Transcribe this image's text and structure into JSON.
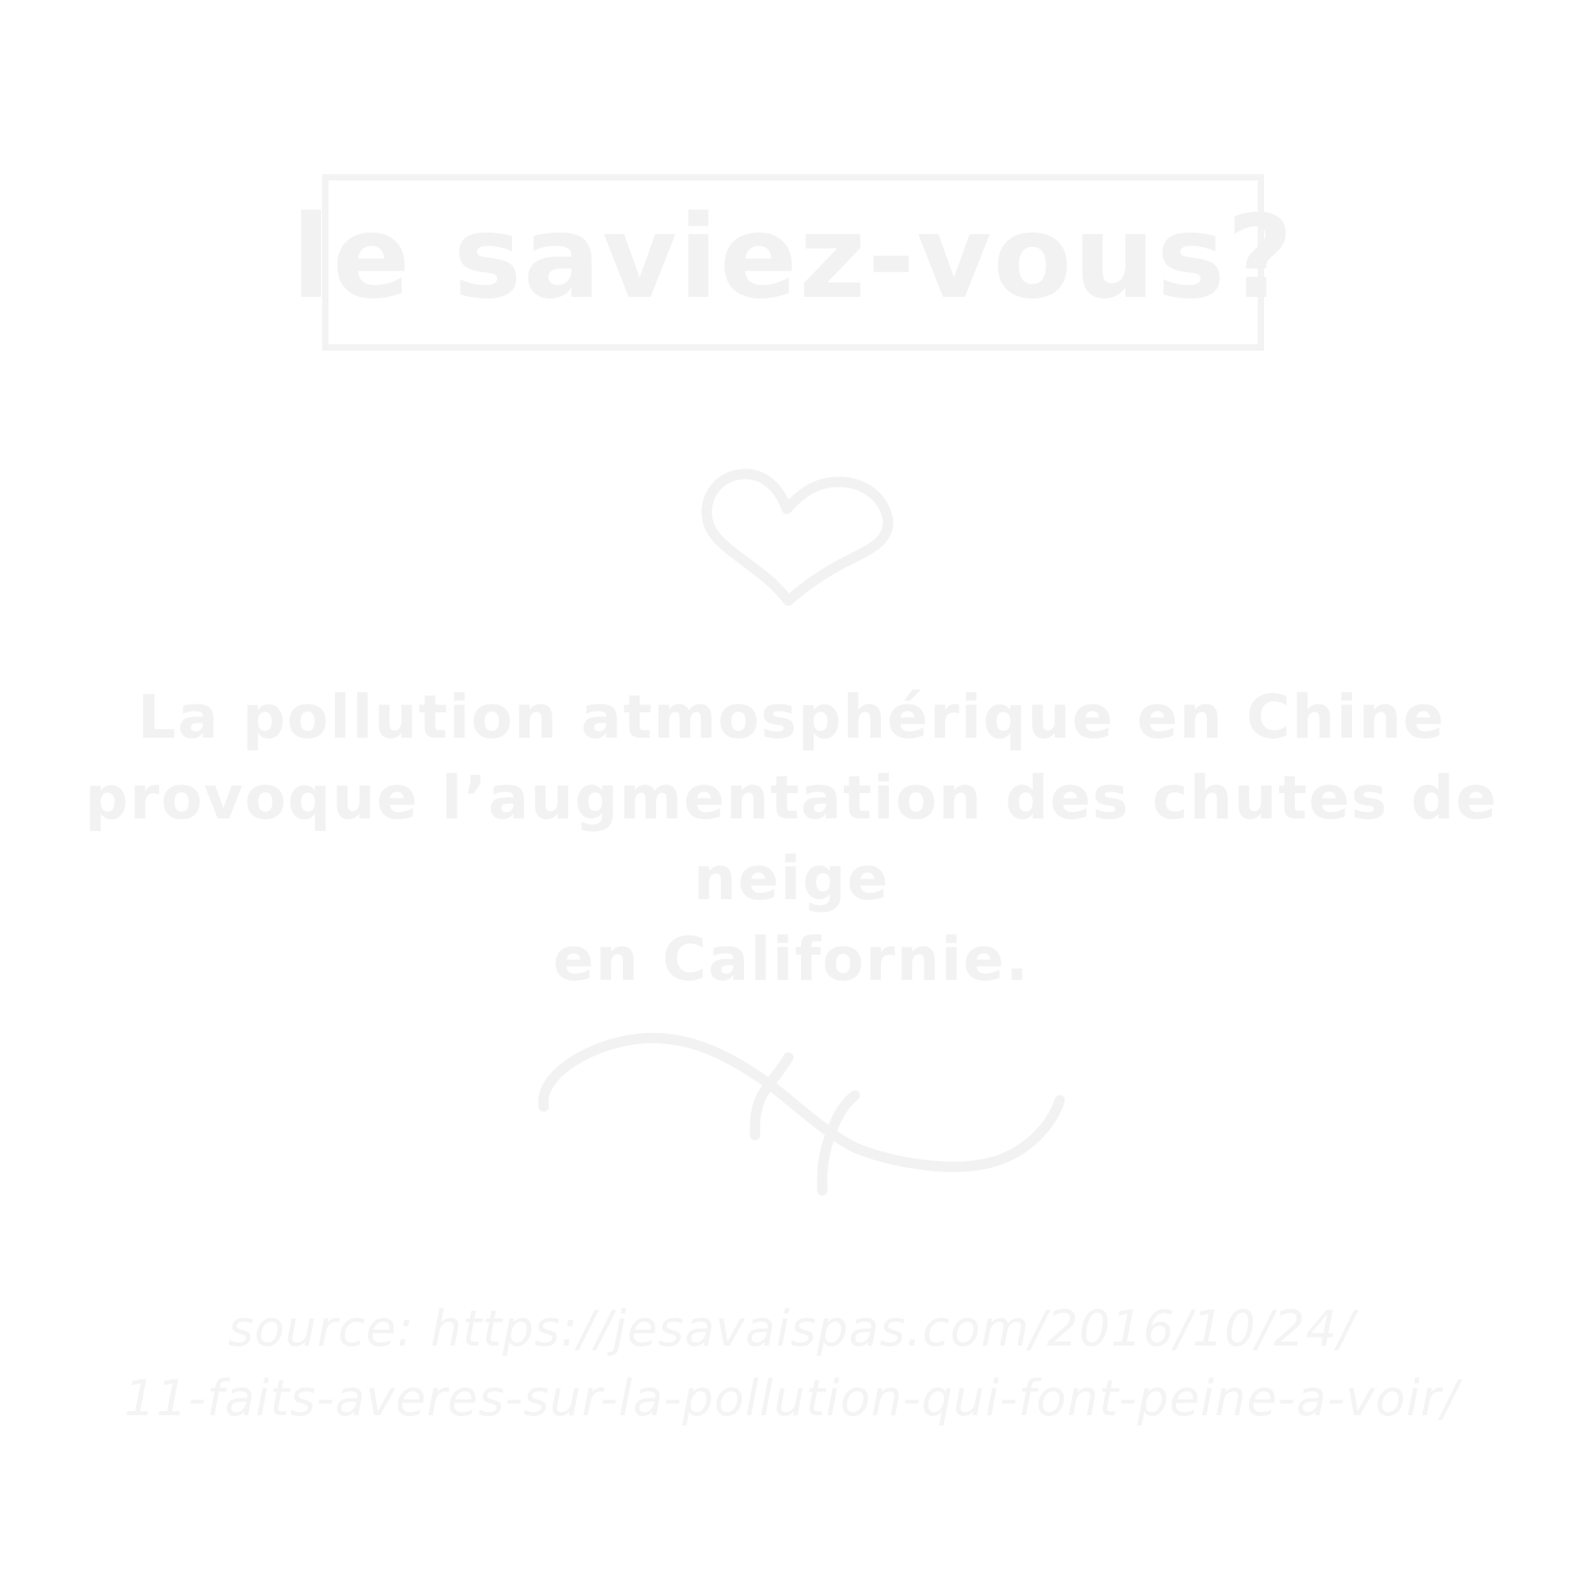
{
  "title": "le saviez-vous?",
  "fact": {
    "line1": "La pollution atmosphérique en Chine",
    "line2": "provoque l’augmentation des chutes de neige",
    "line3": "en Californie."
  },
  "source": {
    "line1": "source: https://jesavaispas.com/2016/10/24/",
    "line2": "11-faits-averes-sur-la-pollution-qui-font-peine-a-voir/"
  },
  "icons": {
    "heart": "heart-icon",
    "divider": "swirl-divider-icon"
  },
  "colors": {
    "background": "#ffffff",
    "foreground": "#f2f2f2"
  }
}
